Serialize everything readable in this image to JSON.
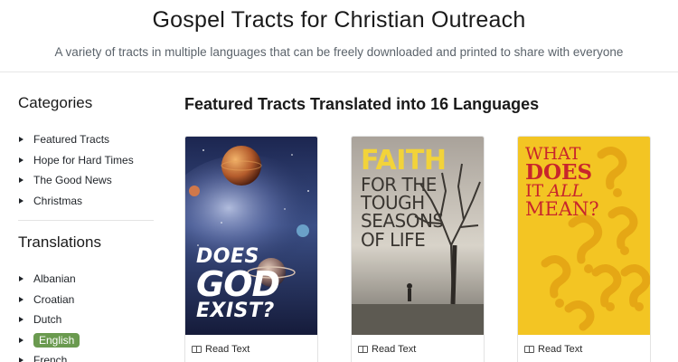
{
  "header": {
    "title": "Gospel Tracts for Christian Outreach",
    "subtitle": "A variety of tracts in multiple languages that can be freely downloaded and printed to share with everyone"
  },
  "sidebar": {
    "categories_heading": "Categories",
    "categories": [
      {
        "label": "Featured Tracts"
      },
      {
        "label": "Hope for Hard Times"
      },
      {
        "label": "The Good News"
      },
      {
        "label": "Christmas"
      }
    ],
    "translations_heading": "Translations",
    "translations": [
      {
        "label": "Albanian"
      },
      {
        "label": "Croatian"
      },
      {
        "label": "Dutch"
      },
      {
        "label": "English",
        "active": true
      },
      {
        "label": "French"
      }
    ]
  },
  "main": {
    "heading": "Featured Tracts Translated into 16 Languages",
    "tracts": [
      {
        "cover_lines": [
          "DOES",
          "GOD",
          "EXIST?"
        ],
        "read_label": "Read Text"
      },
      {
        "cover_lines": [
          "FAITH",
          "FOR THE",
          "TOUGH",
          "SEASONS",
          "OF LIFE"
        ],
        "read_label": "Read Text"
      },
      {
        "cover_lines": [
          "WHAT",
          "DOES",
          "IT",
          "ALL",
          "MEAN?"
        ],
        "read_label": "Read Text"
      }
    ]
  },
  "colors": {
    "active_badge": "#6a9a4f",
    "faith_yellow": "#f2d33a",
    "meaning_yellow": "#f3c523",
    "meaning_red": "#c8252c"
  },
  "icons": [
    "caret-right-icon",
    "book-open-icon"
  ]
}
